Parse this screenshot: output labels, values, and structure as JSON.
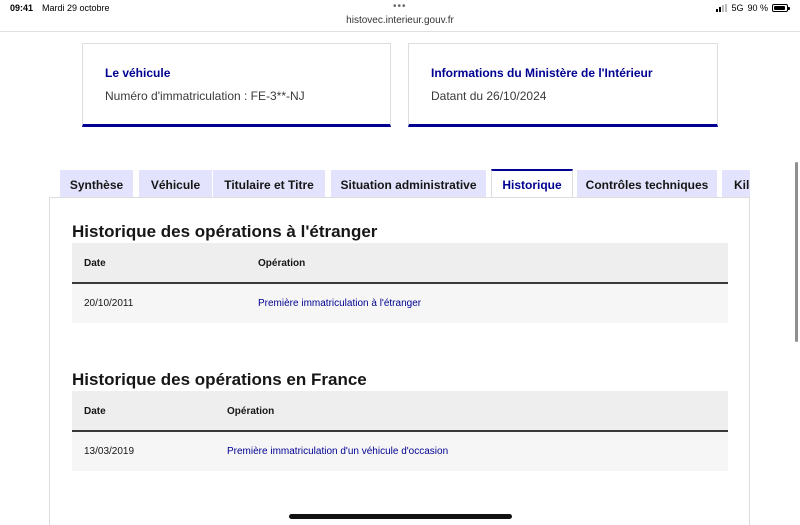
{
  "status_bar": {
    "time": "09:41",
    "date": "Mardi 29 octobre",
    "network": "5G",
    "battery": "90 %",
    "battery_level": 0.9
  },
  "browser": {
    "url": "histovec.interieur.gouv.fr"
  },
  "cards": [
    {
      "title": "Le véhicule",
      "text": "Numéro d'immatriculation : FE-3**-NJ"
    },
    {
      "title": "Informations du Ministère de l'Intérieur",
      "text": "Datant du 26/10/2024"
    }
  ],
  "tabs": [
    {
      "label": "Synthèse",
      "active": false
    },
    {
      "label": "Véhicule",
      "active": false
    },
    {
      "label": "Titulaire et Titre",
      "active": false
    },
    {
      "label": "Situation administrative",
      "active": false
    },
    {
      "label": "Historique",
      "active": true
    },
    {
      "label": "Contrôles techniques",
      "active": false
    },
    {
      "label": "Kilométrage",
      "active": false
    }
  ],
  "sections": [
    {
      "title": "Historique des opérations à l'étranger",
      "columns": [
        "Date",
        "Opération"
      ],
      "rows": [
        {
          "date": "20/10/2011",
          "operation": "Première immatriculation à l'étranger"
        }
      ]
    },
    {
      "title": "Historique des opérations en France",
      "columns": [
        "Date",
        "Opération"
      ],
      "rows": [
        {
          "date": "13/03/2019",
          "operation": "Première immatriculation d'un véhicule d'occasion"
        }
      ]
    }
  ],
  "colors": {
    "accent": "#000091",
    "tab_background": "#e3e3fd",
    "table_header": "#eeeeee",
    "table_row": "#f6f6f6"
  }
}
